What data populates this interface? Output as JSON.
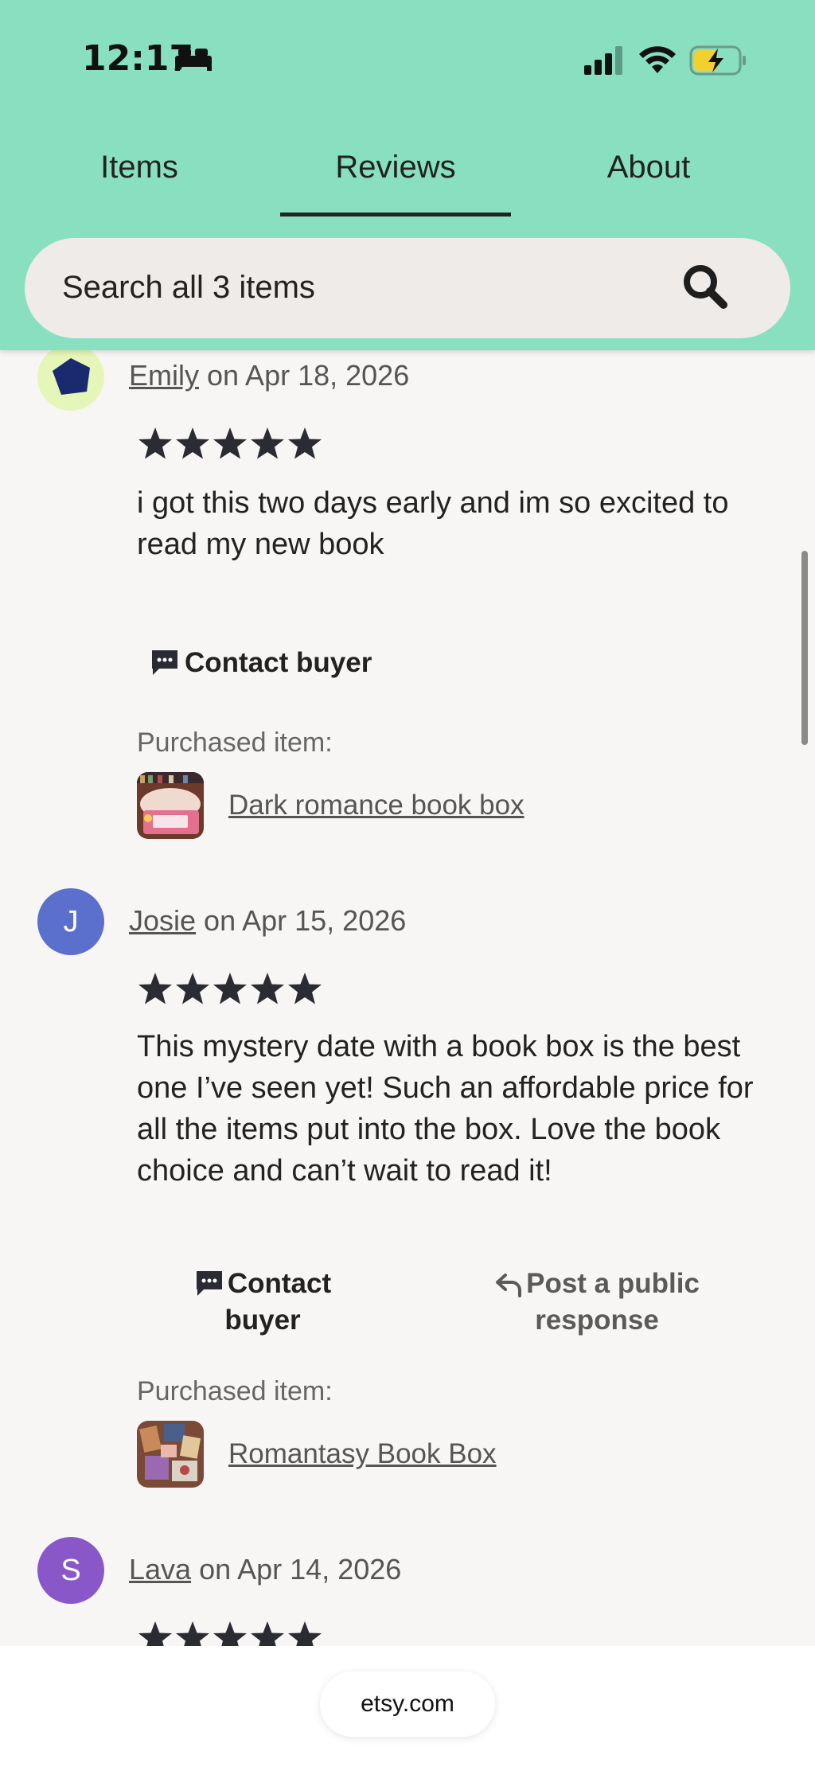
{
  "status_bar": {
    "time": "12:17",
    "icons": [
      "bed-icon",
      "signal-icon",
      "wifi-icon",
      "battery-charging-icon"
    ]
  },
  "tabs": [
    {
      "label": "Items",
      "active": false
    },
    {
      "label": "Reviews",
      "active": true
    },
    {
      "label": "About",
      "active": false
    }
  ],
  "search": {
    "placeholder": "Search all 3 items",
    "icon": "search-icon"
  },
  "reviews": [
    {
      "reviewer": "Emily",
      "date_text": " on Apr 18, 2026",
      "avatar_color": "#1a2a6e",
      "avatar_bg": "#e6f5b8",
      "rating": 5,
      "text": "i got this two days early and im so excited to read my new book",
      "actions": [
        "Contact buyer"
      ],
      "purchased_label": "Purchased item:",
      "item": "Dark romance book box"
    },
    {
      "reviewer": "Josie",
      "date_text": " on Apr 15, 2026",
      "avatar_letter": "J",
      "avatar_color": "#5b6fcc",
      "rating": 5,
      "text": "This mystery date with a book box is the best one I’ve seen yet! Such an affordable price for all the items put into the box. Love the book choice and can’t wait to read it!",
      "actions": [
        "Contact buyer",
        "Post a public response"
      ],
      "purchased_label": "Purchased item:",
      "item": "Romantasy Book Box"
    },
    {
      "reviewer": "Lava",
      "date_text": " on Apr 14, 2026",
      "avatar_letter": "S",
      "avatar_color": "#8a57c9",
      "rating": 5
    }
  ],
  "browser": {
    "url": "etsy.com"
  },
  "colors": {
    "header_bg": "#88e0c1",
    "page_bg": "#f8f6f4",
    "star": "#2b2b33"
  }
}
